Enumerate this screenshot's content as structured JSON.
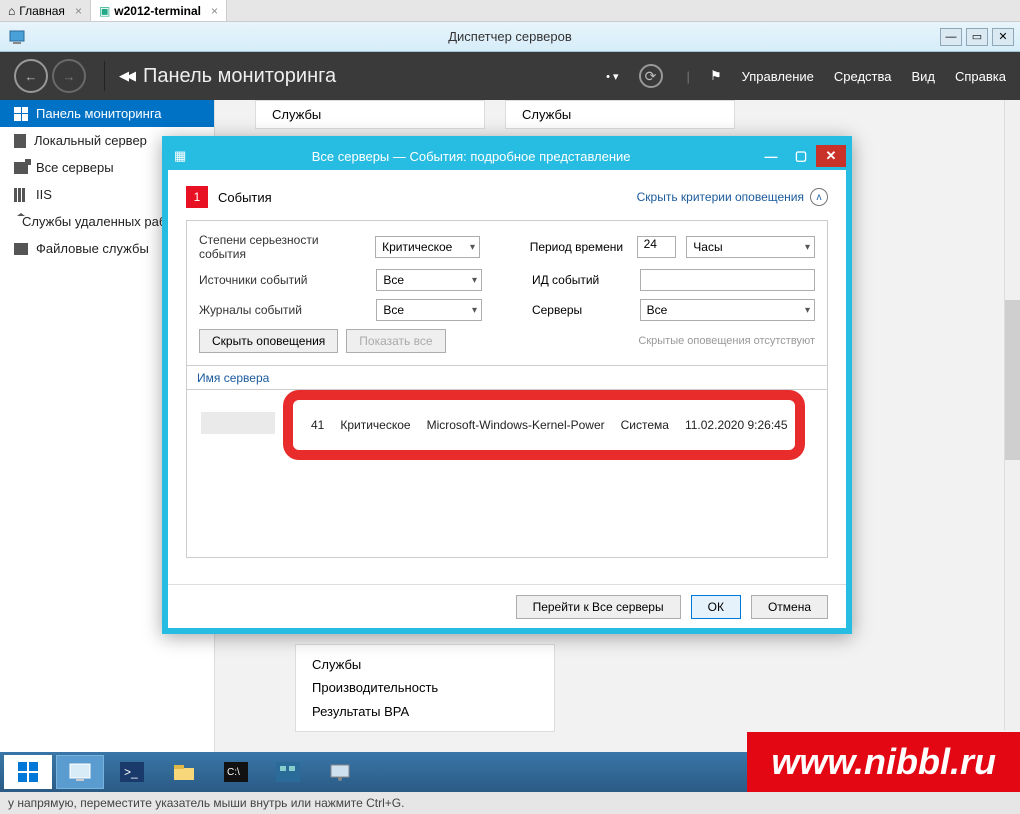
{
  "browser": {
    "tabs": [
      {
        "label": "Главная"
      },
      {
        "label": "w2012-terminal"
      }
    ]
  },
  "window": {
    "title": "Диспетчер серверов"
  },
  "ribbon": {
    "back": "◀◀",
    "title": "Панель мониторинга",
    "menu": {
      "manage": "Управление",
      "tools": "Средства",
      "view": "Вид",
      "help": "Справка"
    }
  },
  "sidebar": {
    "items": [
      {
        "label": "Панель мониторинга",
        "icon": "dashboard"
      },
      {
        "label": "Локальный сервер",
        "icon": "server"
      },
      {
        "label": "Все серверы",
        "icon": "servers"
      },
      {
        "label": "IIS",
        "icon": "iis"
      },
      {
        "label": "Службы удаленных рабочих столов",
        "icon": "remote"
      },
      {
        "label": "Файловые службы",
        "icon": "file"
      }
    ]
  },
  "cards": {
    "top": [
      "Службы",
      "Службы"
    ],
    "bottom": [
      "Службы",
      "Производительность",
      "Результаты BPA"
    ]
  },
  "modal": {
    "title": "Все серверы — События: подробное представление",
    "badge": "1",
    "badge_label": "События",
    "hide_criteria": "Скрыть критерии оповещения",
    "filters": {
      "severity_label": "Степени серьезности события",
      "severity_value": "Критическое",
      "sources_label": "Источники событий",
      "sources_value": "Все",
      "logs_label": "Журналы событий",
      "logs_value": "Все",
      "period_label": "Период времени",
      "period_value": "24",
      "period_unit": "Часы",
      "eventid_label": "ИД событий",
      "eventid_value": "",
      "servers_label": "Серверы",
      "servers_value": "Все"
    },
    "buttons": {
      "hide_alerts": "Скрыть оповещения",
      "show_all": "Показать все",
      "none_hidden": "Скрытые оповещения отсутствуют"
    },
    "grid": {
      "col1": "Имя сервера",
      "row": {
        "id": "41",
        "severity": "Критическое",
        "source": "Microsoft-Windows-Kernel-Power",
        "log": "Система",
        "datetime": "11.02.2020 9:26:45"
      }
    },
    "footer": {
      "goto": "Перейти к Все серверы",
      "ok": "ОК",
      "cancel": "Отмена"
    }
  },
  "banner": "www.nibbl.ru",
  "status": "у напрямую, переместите указатель мыши внутрь или нажмите Ctrl+G."
}
